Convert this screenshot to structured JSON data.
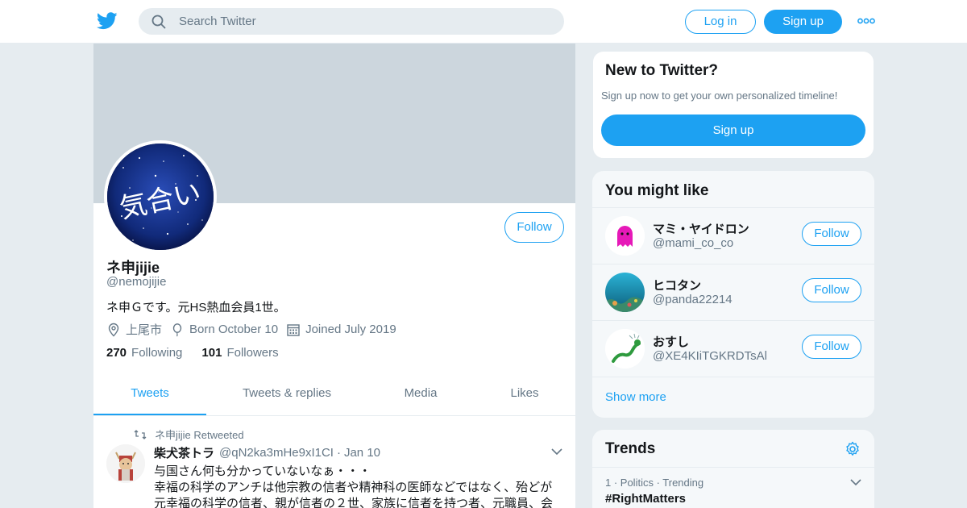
{
  "colors": {
    "accent": "#1da1f2",
    "muted": "#657786",
    "banner": "#ccd6dd",
    "page_bg": "#e6ecf0"
  },
  "header": {
    "logo_icon": "twitter-bird-icon",
    "search_placeholder": "Search Twitter",
    "login_label": "Log in",
    "signup_label": "Sign up",
    "more_icon": "more-dots-icon"
  },
  "profile": {
    "avatar_text": "気合い",
    "follow_label": "Follow",
    "display_name": "ネ申jijie",
    "handle": "@nemojijie",
    "bio": "ネ申Ｇです。元HS熱血会員1世。",
    "location": "上尾市",
    "birthday": "Born October 10",
    "joined": "Joined July 2019",
    "following_count": "270",
    "following_label": "Following",
    "followers_count": "101",
    "followers_label": "Followers",
    "tabs": [
      {
        "label": "Tweets"
      },
      {
        "label": "Tweets & replies"
      },
      {
        "label": "Media"
      },
      {
        "label": "Likes"
      }
    ]
  },
  "tweet": {
    "retweet_note": "ネ申jijie Retweeted",
    "author_name": "柴犬茶トラ",
    "author_handle": "@qN2ka3mHe9xI1CI",
    "separator": "·",
    "date": "Jan 10",
    "lines": [
      "与国さん何も分かっていないなぁ・・・",
      "幸福の科学のアンチは他宗教の信者や精神科の医師などではなく、殆どが",
      "元幸福の科学の信者、親が信者の２世、家族に信者を持つ者、元職員、会"
    ]
  },
  "new_to_twitter": {
    "title": "New to Twitter?",
    "subtitle": "Sign up now to get your own personalized timeline!",
    "signup_label": "Sign up"
  },
  "you_might_like": {
    "title": "You might like",
    "users": [
      {
        "name": "マミ・ヤイドロン",
        "handle": "@mami_co_co",
        "follow_label": "Follow"
      },
      {
        "name": "ヒコタン",
        "handle": "@panda22214",
        "follow_label": "Follow"
      },
      {
        "name": "おすし",
        "handle": "@XE4KIiTGKRDTsAl",
        "follow_label": "Follow"
      }
    ],
    "show_more": "Show more"
  },
  "trends": {
    "title": "Trends",
    "items": [
      {
        "meta": "1 · Politics · Trending",
        "name": "#RightMatters"
      }
    ]
  }
}
